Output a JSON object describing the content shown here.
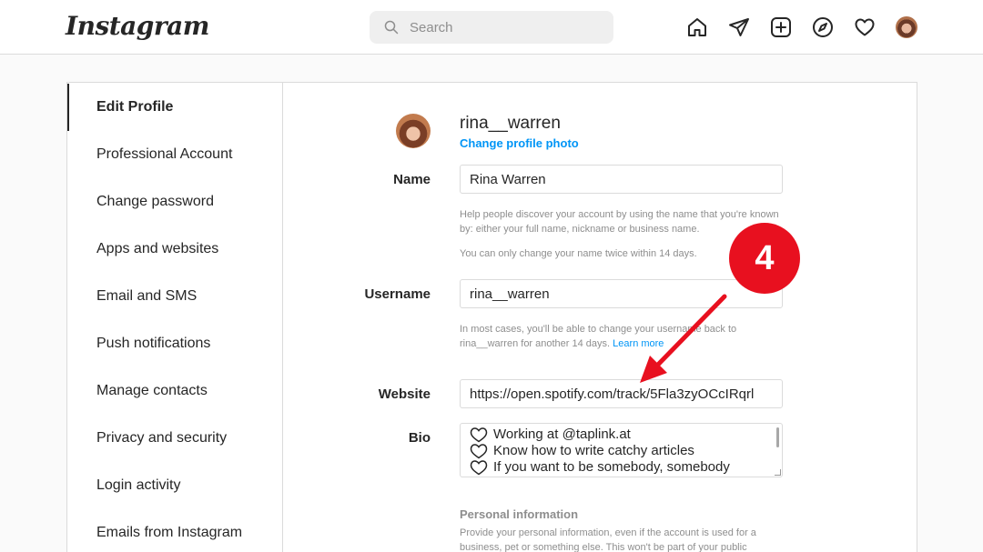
{
  "app": {
    "logo": "Instagram"
  },
  "search": {
    "placeholder": "Search"
  },
  "nav": {
    "icons": [
      "home-icon",
      "paper-plane-icon",
      "new-post-icon",
      "explore-compass-icon",
      "heart-icon",
      "avatar"
    ]
  },
  "sidebar": {
    "items": [
      {
        "label": "Edit Profile",
        "active": true
      },
      {
        "label": "Professional Account"
      },
      {
        "label": "Change password"
      },
      {
        "label": "Apps and websites"
      },
      {
        "label": "Email and SMS"
      },
      {
        "label": "Push notifications"
      },
      {
        "label": "Manage contacts"
      },
      {
        "label": "Privacy and security"
      },
      {
        "label": "Login activity"
      },
      {
        "label": "Emails from Instagram"
      }
    ]
  },
  "profile": {
    "username": "rina__warren",
    "change_photo": "Change profile photo"
  },
  "form": {
    "name_label": "Name",
    "name_value": "Rina Warren",
    "name_help_1": "Help people discover your account by using the name that you're known by: either your full name, nickname or business name.",
    "name_help_2": "You can only change your name twice within 14 days.",
    "username_label": "Username",
    "username_value": "rina__warren",
    "username_help": "In most cases, you'll be able to change your username back to rina__warren for another 14 days.",
    "username_help_link": "Learn more",
    "website_label": "Website",
    "website_value": "https://open.spotify.com/track/5Fla3zyOCcIRqrl",
    "bio_label": "Bio",
    "bio_lines": [
      "Working at @taplink.at",
      "Know how to write catchy articles",
      "If you want to be somebody, somebody"
    ],
    "personal_title": "Personal information",
    "personal_help": "Provide your personal information, even if the account is used for a business, pet or something else. This won't be part of your public"
  },
  "annotation": {
    "step": "4",
    "color": "#e8101f"
  }
}
